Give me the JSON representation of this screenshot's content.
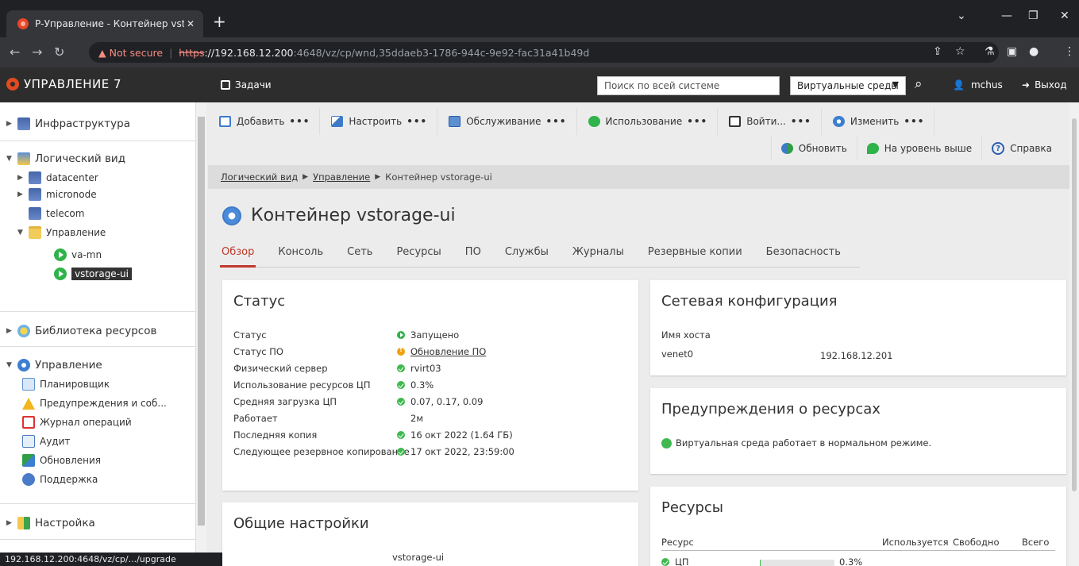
{
  "browser": {
    "tab_title": "Р-Управление - Контейнер vsto",
    "tab_close": "✕",
    "new_tab": "+",
    "url_warning": "Not secure",
    "url_protocol": "https",
    "url_host": "192.168.12.200",
    "url_path": ":4648/vz/cp/wnd,35ddaeb3-1786-944c-9e92-fac31a41b49d",
    "status_url": "192.168.12.200:4648/vz/cp/.../upgrade"
  },
  "header": {
    "brand": "УПРАВЛЕНИЕ 7",
    "tasks_label": "Задачи",
    "search_placeholder": "Поиск по всей системе",
    "env_select": "Виртуальные среды",
    "user": "mchus",
    "logout": "Выход"
  },
  "sidebar": {
    "infrastructure": "Инфраструктура",
    "logical_view": "Логический вид",
    "datacenter": "datacenter",
    "micronode": "micronode",
    "telecom": "telecom",
    "management_folder": "Управление",
    "va_mn": "va-mn",
    "vstorage_ui": "vstorage-ui",
    "resource_library": "Библиотека ресурсов",
    "management": "Управление",
    "scheduler": "Планировщик",
    "alerts": "Предупреждения и соб...",
    "operations_log": "Журнал операций",
    "audit": "Аудит",
    "updates": "Обновления",
    "support": "Поддержка",
    "settings": "Настройка"
  },
  "toolbar": {
    "add": "Добавить",
    "configure": "Настроить",
    "maintenance": "Обслуживание",
    "usage": "Использование",
    "login": "Войти...",
    "change": "Изменить",
    "dots": "•••",
    "refresh": "Обновить",
    "up_level": "На уровень выше",
    "help": "Справка"
  },
  "breadcrumb": {
    "item1": "Логический вид",
    "item2": "Управление",
    "item3": "Контейнер vstorage-ui"
  },
  "page": {
    "title": "Контейнер vstorage-ui"
  },
  "tabs": [
    "Обзор",
    "Консоль",
    "Сеть",
    "Ресурсы",
    "ПО",
    "Службы",
    "Журналы",
    "Резервные копии",
    "Безопасность"
  ],
  "status_card": {
    "title": "Статус",
    "rows": [
      {
        "label": "Статус",
        "value": "Запущено"
      },
      {
        "label": "Статус ПО",
        "value": "Обновление ПО"
      },
      {
        "label": "Физический сервер",
        "value": "rvirt03"
      },
      {
        "label": "Использование ресурсов ЦП",
        "value": "0.3%"
      },
      {
        "label": "Средняя загрузка ЦП",
        "value": "0.07, 0.17, 0.09"
      },
      {
        "label": "Работает",
        "value": "2м"
      },
      {
        "label": "Последняя копия",
        "value": "16 окт 2022 (1.64 ГБ)"
      },
      {
        "label": "Следующее резервное копирование",
        "value": "17 окт 2022, 23:59:00"
      }
    ]
  },
  "general_card": {
    "title": "Общие настройки",
    "value": "vstorage-ui"
  },
  "network_card": {
    "title": "Сетевая конфигурация",
    "hostname_label": "Имя хоста",
    "iface": "venet0",
    "ip": "192.168.12.201"
  },
  "alerts_card": {
    "title": "Предупреждения о ресурсах",
    "message": "Виртуальная среда работает в нормальном режиме."
  },
  "resources_card": {
    "title": "Ресурсы",
    "col_resource": "Ресурс",
    "col_used": "Используется",
    "col_free": "Свободно",
    "col_total": "Всего",
    "row_cpu": "ЦП",
    "row_cpu_value": "0.3%",
    "cpu_fraction": 0.003
  }
}
